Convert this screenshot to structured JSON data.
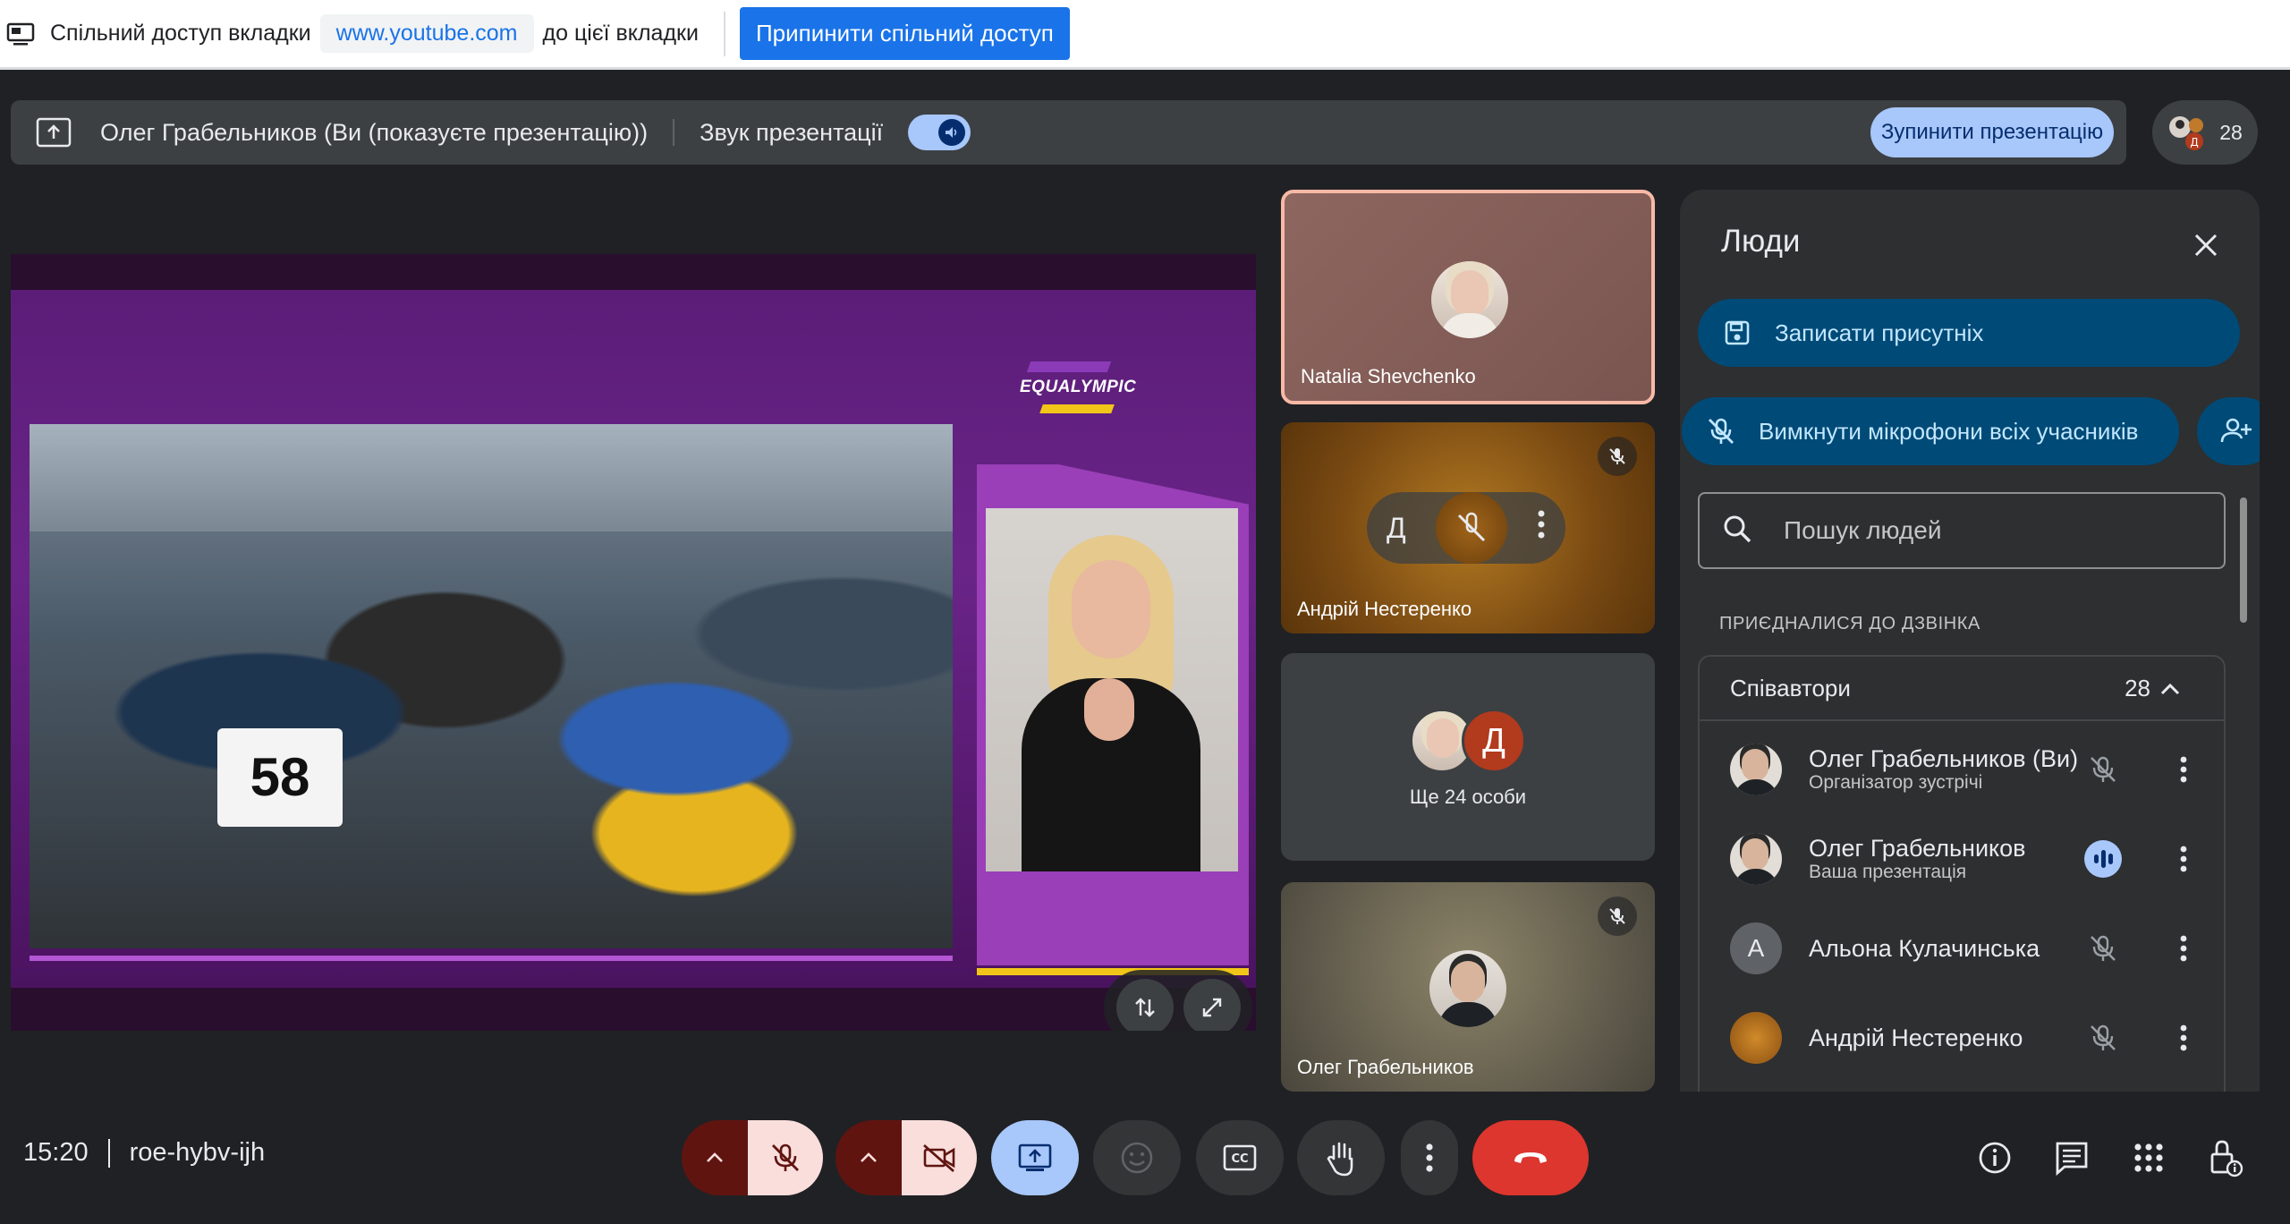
{
  "sharebar": {
    "label_before": "Спільний доступ вкладки",
    "url": "www.youtube.com",
    "label_after": "до цієї вкладки",
    "stop_button": "Припинити спільний доступ"
  },
  "presentation_banner": {
    "presenter": "Олег Грабельников (Ви (показуєте презентацію))",
    "audio_label": "Звук презентації",
    "audio_on": true,
    "stop_button": "Зупинити презентацію",
    "participant_count": "28"
  },
  "stage": {
    "logo_text": "EQUALYMPIC",
    "bib_number": "58"
  },
  "tiles": [
    {
      "name": "Natalia Shevchenko",
      "muted": false,
      "active_speaker": true
    },
    {
      "name": "Андрій Нестеренко",
      "muted": true,
      "pin_glyph": "Д"
    },
    {
      "more_label": "Ще 24 особи",
      "avatar_letter": "Д"
    },
    {
      "name": "Олег Грабельников",
      "muted": true
    }
  ],
  "people_panel": {
    "title": "Люди",
    "record_button": "Записати присутніх",
    "mute_all_button": "Вимкнути мікрофони всіх учасників",
    "search_placeholder": "Пошук людей",
    "section_label": "ПРИЄДНАЛИСЯ ДО ДЗВІНКА",
    "group": {
      "name": "Співавтори",
      "count": "28"
    },
    "people": [
      {
        "name": "Олег Грабельников (Ви)",
        "subtitle": "Організатор зустрічі",
        "status": "muted"
      },
      {
        "name": "Олег Грабельников",
        "subtitle": "Ваша презентація",
        "status": "speaking"
      },
      {
        "name": "Альона Кулачинська",
        "subtitle": "",
        "avatar_letter": "А",
        "status": "muted"
      },
      {
        "name": "Андрій Нестеренко",
        "subtitle": "",
        "status": "muted"
      }
    ]
  },
  "bottom_bar": {
    "time": "15:20",
    "meeting_code": "roe-hybv-ijh"
  },
  "colors": {
    "accent": "#a8c7fa",
    "danger": "#dc362e",
    "panel": "#2d2f31",
    "background": "#202124"
  }
}
